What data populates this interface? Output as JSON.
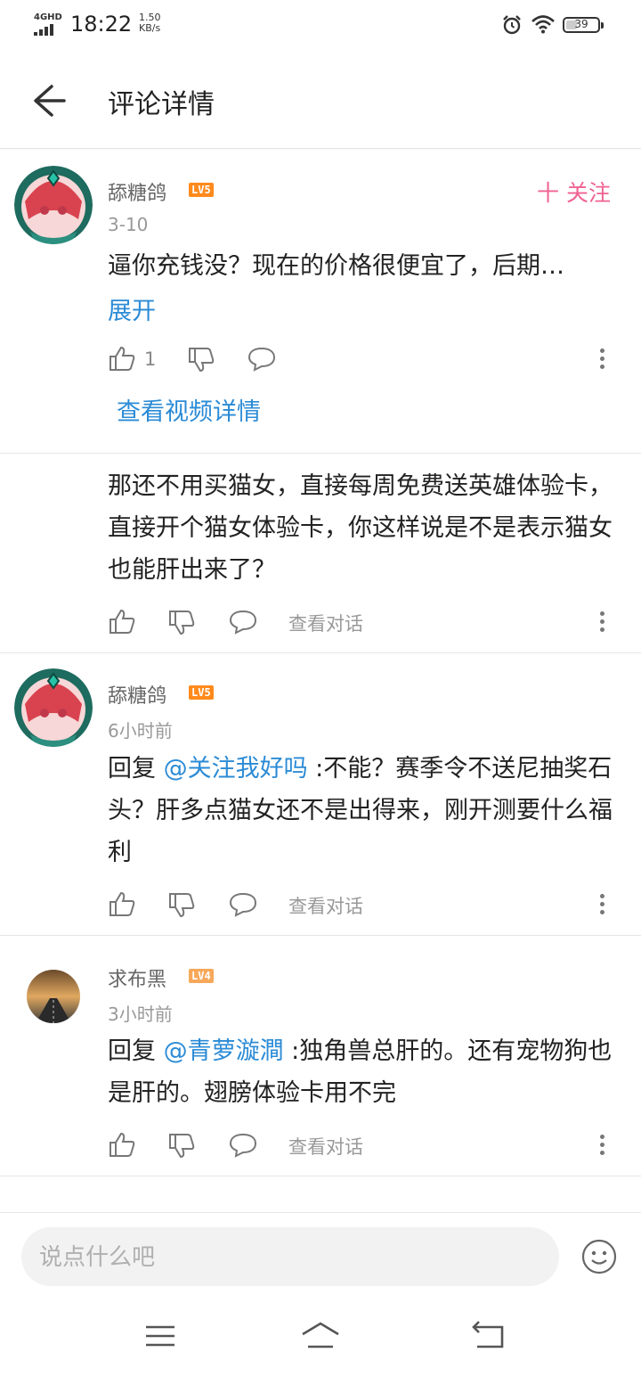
{
  "status_bar": {
    "network": "4GHD",
    "time": "18:22",
    "speed_value": "1.50",
    "speed_unit": "KB/s",
    "battery": "39"
  },
  "header": {
    "title": "评论详情"
  },
  "main_comment": {
    "username": "舔糖鸽",
    "level": "LV5",
    "time": "3-10",
    "text": "逼你充钱没？现在的价格很便宜了，后期…",
    "expand_label": "展开",
    "like_count": "1",
    "follow_label": "十 关注",
    "video_link": "查看视频详情"
  },
  "replies": [
    {
      "text": "那还不用买猫女，直接每周免费送英雄体验卡，直接开个猫女体验卡，你这样说是不是表示猫女也能肝出来了？",
      "talk_label": "查看对话"
    },
    {
      "username": "舔糖鸽",
      "level": "LV5",
      "time": "6小时前",
      "reply_prefix": "回复 ",
      "mention": "@关注我好吗",
      "text": " :不能？赛季令不送尼抽奖石头？肝多点猫女还不是出得来，刚开测要什么福利",
      "talk_label": "查看对话"
    },
    {
      "username": "求布黑",
      "level": "LV4",
      "time": "3小时前",
      "reply_prefix": "回复 ",
      "mention": "@青萝漩澗",
      "text": " :独角兽总肝的。还有宠物狗也是肝的。翅膀体验卡用不完",
      "talk_label": "查看对话"
    }
  ],
  "bottom": {
    "placeholder": "说点什么吧"
  },
  "colors": {
    "accent_blue": "#2b8bd6",
    "follow_pink": "#f06292",
    "level5": "#ff8a1c",
    "level4": "#f7a85a"
  }
}
